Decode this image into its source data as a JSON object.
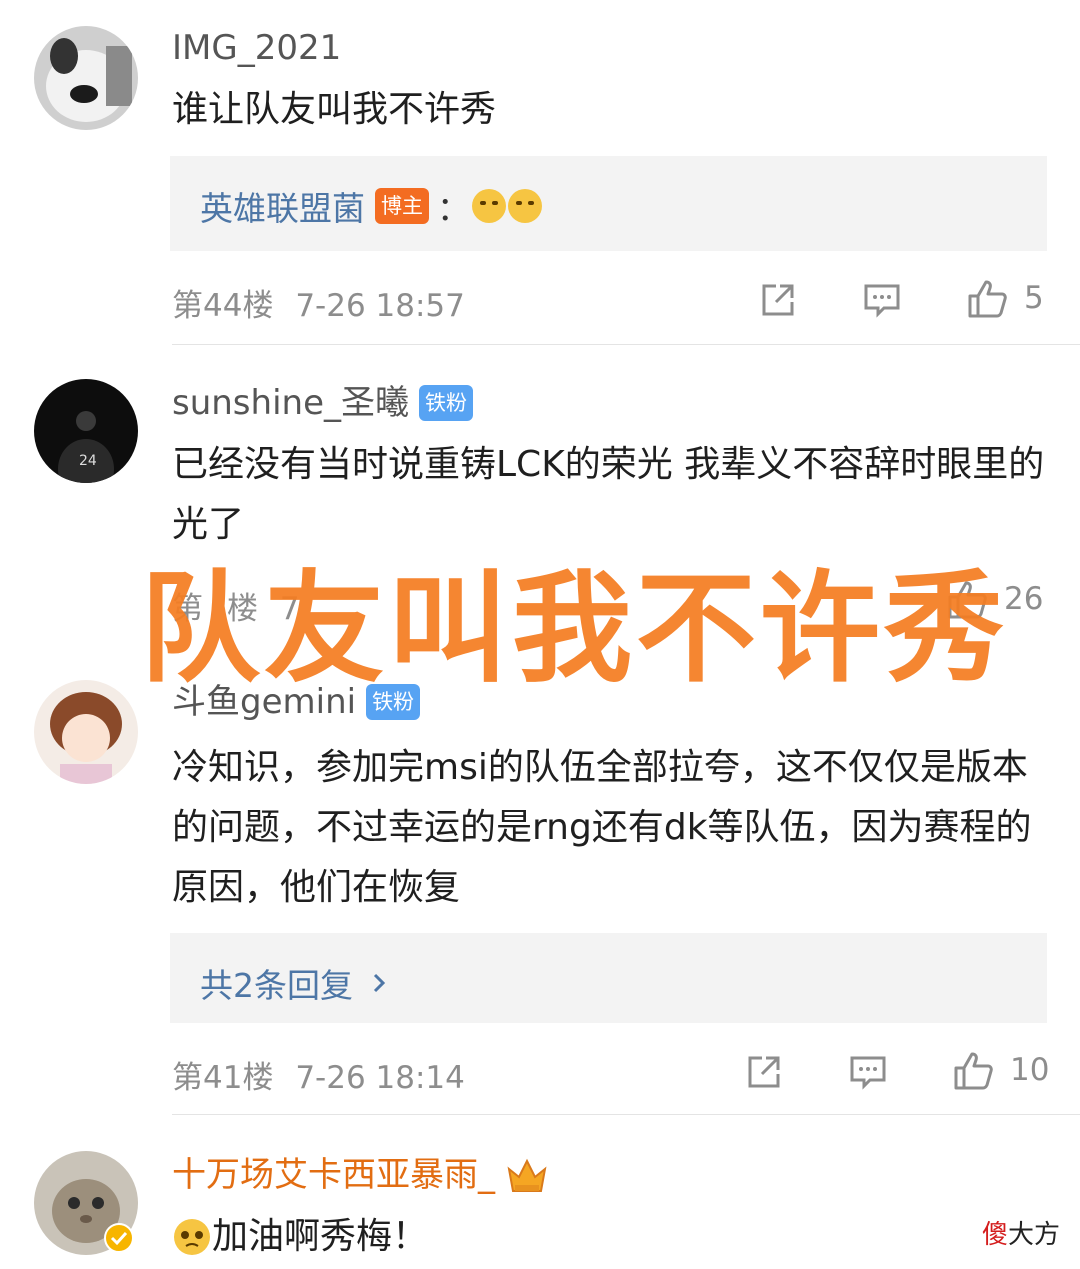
{
  "comments": [
    {
      "username": "IMG_2021",
      "text": "谁让队友叫我不许秀",
      "reply": {
        "author": "英雄联盟菌",
        "author_badge": "博主",
        "colon": "：",
        "emoji": "laugh-cry-emoji"
      },
      "floor": "第44楼",
      "date": "7-26 18:57",
      "likes": "5"
    },
    {
      "username": "sunshine_圣曦",
      "badge": "铁粉",
      "text": "已经没有当时说重铸LCK的荣光 我辈义不容辞时眼里的光了",
      "floor": "第",
      "floor_tail": "楼",
      "date": "7",
      "likes": "26"
    },
    {
      "username": "斗鱼gemini",
      "badge": "铁粉",
      "text": "冷知识，参加完msi的队伍全部拉夸，这不仅仅是版本的问题，不过幸运的是rng还有dk等队伍，因为赛程的原因，他们在恢复",
      "replies_link": "共2条回复",
      "floor": "第41楼",
      "date": "7-26 18:14",
      "likes": "10"
    },
    {
      "username": "十万场艾卡西亚暴雨_",
      "text": "加油啊秀梅！"
    }
  ],
  "overlay_caption": "队友叫我不许秀",
  "corner_mark": {
    "red_char": "傻",
    "rest": "大方"
  },
  "colors": {
    "accent": "#f57d22",
    "link": "#4d76a6",
    "badge_blue": "#57a3f3",
    "badge_orange": "#f36c21",
    "gold_name": "#e26d12"
  },
  "icons": [
    "forward-icon",
    "comment-icon",
    "like-icon",
    "chevron-right-icon",
    "vip-crown-icon",
    "verified-icon"
  ]
}
